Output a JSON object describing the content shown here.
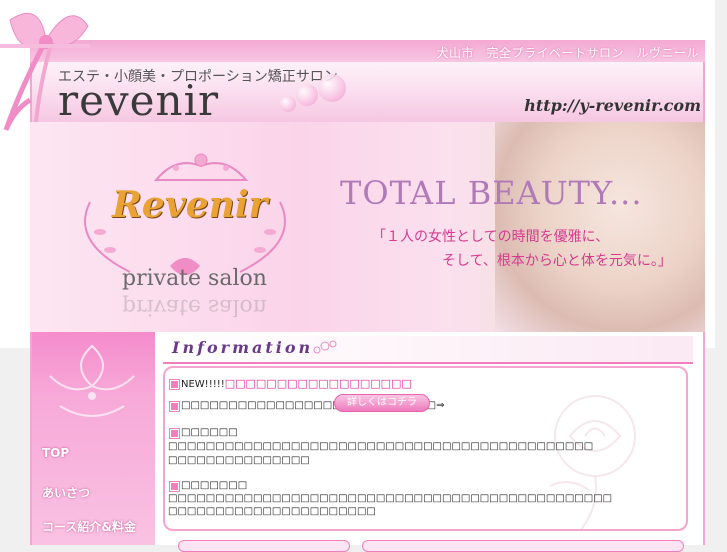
{
  "header": {
    "tagline": "犬山市　完全プライベートサロン　ルヴニール",
    "subtitle": "エステ・小顔美・プロポーション矯正サロン",
    "logo": "revenir",
    "url": "http://y-revenir.com"
  },
  "hero": {
    "brand": "Revenir",
    "private_salon": "private salon",
    "title": "TOTAL BEAUTY...",
    "line1": "「１人の女性としての時間を優雅に、",
    "line2": "そして、根本から心と体を元気に。」"
  },
  "nav": {
    "items": [
      {
        "label": "TOP"
      },
      {
        "label": "あいさつ"
      },
      {
        "label": "コース紹介&料金"
      }
    ]
  },
  "info": {
    "title": "Information",
    "item1_prefix": "NEW!!!!!",
    "item1_link": "□□□□□□□□□□□□□□□□□□",
    "item2_text": "□□□□□□□□□□□□□□□□□□□□□□□□□□□⇒",
    "more_button": "詳しくはコチラ",
    "item3_heading": "□□□□□□",
    "item3_line1": "□□□□□□□□□□□□□□□□□□□□□□□□□□□□□□□□□□□□□□□□□□□□□",
    "item3_line2": "□□□□□□□□□□□□□□□",
    "item4_heading": "□□□□□□□",
    "item4_line1": "□□□□□□□□□□□□□□□□□□□□□□□□□□□□□□□□□□□□□□□□□□□□□□□",
    "item4_line2": "□□□□□□□□□□□□□□□□□□□□□□"
  },
  "colors": {
    "accent_pink": "#f27fbf",
    "link_pink": "#e0279a",
    "title_purple": "#b07ab8"
  }
}
